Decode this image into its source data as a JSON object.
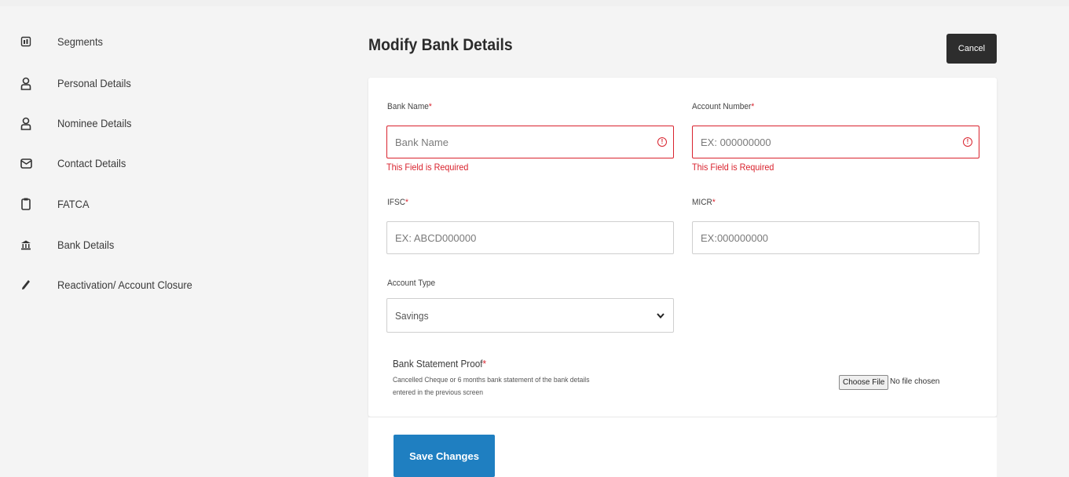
{
  "sidebar": {
    "items": [
      {
        "label": "Segments",
        "icon": "segments-icon"
      },
      {
        "label": "Personal Details",
        "icon": "person-icon"
      },
      {
        "label": "Nominee Details",
        "icon": "person-icon"
      },
      {
        "label": "Contact Details",
        "icon": "envelope-icon"
      },
      {
        "label": "FATCA",
        "icon": "clipboard-icon"
      },
      {
        "label": "Bank Details",
        "icon": "bank-icon"
      },
      {
        "label": "Reactivation/ Account Closure",
        "icon": "pencil-icon"
      }
    ]
  },
  "header": {
    "title": "Modify Bank Details",
    "cancel_label": "Cancel"
  },
  "form": {
    "required_mark": "*",
    "bank_name": {
      "label": "Bank Name",
      "placeholder": "Bank Name",
      "error": "This Field is Required"
    },
    "account_number": {
      "label": "Account Number",
      "placeholder": "EX: 000000000",
      "error": "This Field is Required"
    },
    "ifsc": {
      "label": "IFSC",
      "placeholder": "EX: ABCD000000"
    },
    "micr": {
      "label": "MICR",
      "placeholder": "EX:000000000"
    },
    "account_type": {
      "label": "Account Type",
      "value": "Savings"
    },
    "proof": {
      "title": "Bank Statement Proof",
      "description": "Cancelled Cheque or 6 months bank statement of the bank details entered in the previous screen",
      "choose_label": "Choose File",
      "file_status": "No file chosen"
    },
    "save_label": "Save Changes"
  },
  "colors": {
    "error": "#d9232e",
    "primary": "#1f7fc1",
    "dark_button": "#2d2d2d"
  }
}
